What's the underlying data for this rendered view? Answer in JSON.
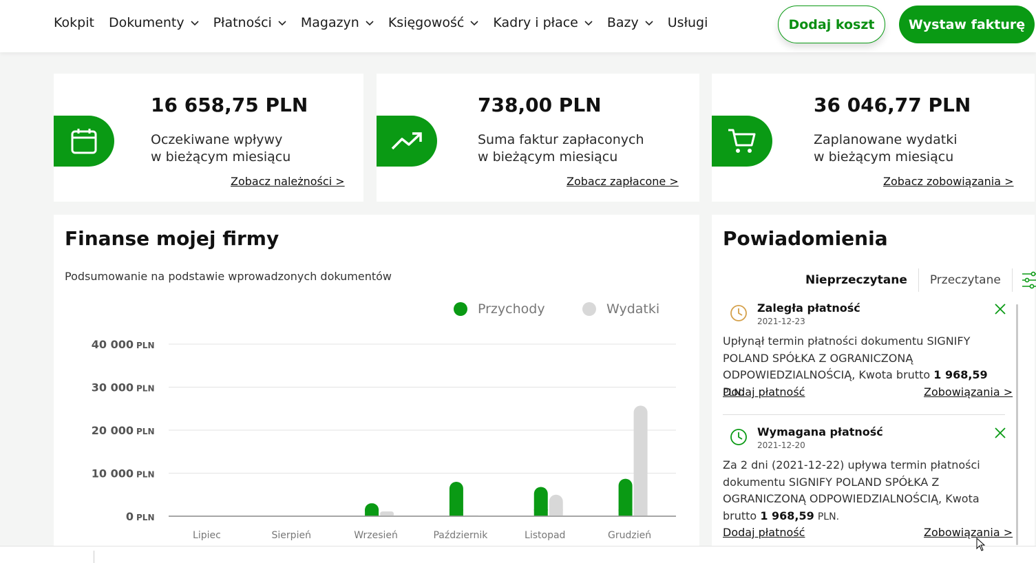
{
  "nav": {
    "items": [
      {
        "label": "Kokpit",
        "dropdown": false
      },
      {
        "label": "Dokumenty",
        "dropdown": true
      },
      {
        "label": "Płatności",
        "dropdown": true
      },
      {
        "label": "Magazyn",
        "dropdown": true
      },
      {
        "label": "Księgowość",
        "dropdown": true
      },
      {
        "label": "Kadry i płace",
        "dropdown": true
      },
      {
        "label": "Bazy",
        "dropdown": true
      },
      {
        "label": "Usługi",
        "dropdown": false
      }
    ],
    "add_cost": "Dodaj koszt",
    "issue_invoice": "Wystaw fakturę"
  },
  "stats": [
    {
      "amount": "16 658,75 PLN",
      "desc": "Oczekiwane wpływy\nw bieżącym miesiącu",
      "link": "Zobacz należności >",
      "icon": "calendar-icon"
    },
    {
      "amount": "738,00 PLN",
      "desc": "Suma faktur zapłaconych\nw bieżącym miesiącu",
      "link": "Zobacz zapłacone >",
      "icon": "trend-up-icon"
    },
    {
      "amount": "36 046,77 PLN",
      "desc": "Zaplanowane wydatki\nw bieżącym miesiącu",
      "link": "Zobacz zobowiązania >",
      "icon": "cart-icon"
    }
  ],
  "finance": {
    "title": "Finanse mojej firmy",
    "subtitle": "Podsumowanie na podstawie wprowadzonych dokumentów",
    "legend": {
      "income": "Przychody",
      "expenses": "Wydatki"
    }
  },
  "chart_data": {
    "type": "bar",
    "categories": [
      "Lipiec",
      "Sierpień",
      "Wrzesień",
      "Październik",
      "Listopad",
      "Grudzień"
    ],
    "series": [
      {
        "name": "Przychody",
        "color": "#0a9a14",
        "values": [
          0,
          0,
          3000,
          8000,
          6800,
          8700
        ]
      },
      {
        "name": "Wydatki",
        "color": "#d8d8d8",
        "values": [
          0,
          0,
          1100,
          200,
          5000,
          25700
        ]
      }
    ],
    "yticks": [
      {
        "value": 40000,
        "label": "40 000",
        "unit": "PLN"
      },
      {
        "value": 30000,
        "label": "30 000",
        "unit": "PLN"
      },
      {
        "value": 20000,
        "label": "20 000",
        "unit": "PLN"
      },
      {
        "value": 10000,
        "label": "10 000",
        "unit": "PLN"
      },
      {
        "value": 0,
        "label": "0",
        "unit": "PLN"
      }
    ],
    "ylim": [
      0,
      40000
    ],
    "legend_position": "top-right",
    "grid": true
  },
  "notifications": {
    "title": "Powiadomienia",
    "tabs": {
      "unread": "Nieprzeczytane",
      "read": "Przeczytane"
    },
    "items": [
      {
        "title": "Zaległa płatność",
        "date": "2021-12-23",
        "clock_color": "#d4a04a",
        "text": "Upłynął termin płatności dokumentu SIGNIFY POLAND SPÓŁKA Z OGRANICZONĄ ODPOWIEDZIALNOŚCIĄ, Kwota brutto",
        "amount": "1 968,59",
        "unit": "PLN.",
        "action_pay": "Dodaj płatność",
        "action_liab": "Zobowiązania >"
      },
      {
        "title": "Wymagana płatność",
        "date": "2021-12-20",
        "clock_color": "#0a9a14",
        "text": "Za 2 dni (2021-12-22) upływa termin płatności dokumentu SIGNIFY POLAND SPÓŁKA Z OGRANICZONĄ ODPOWIEDZIALNOŚCIĄ, Kwota brutto",
        "amount": "1 968,59",
        "unit": "PLN.",
        "action_pay": "Dodaj płatność",
        "action_liab": "Zobowiązania >"
      }
    ]
  }
}
